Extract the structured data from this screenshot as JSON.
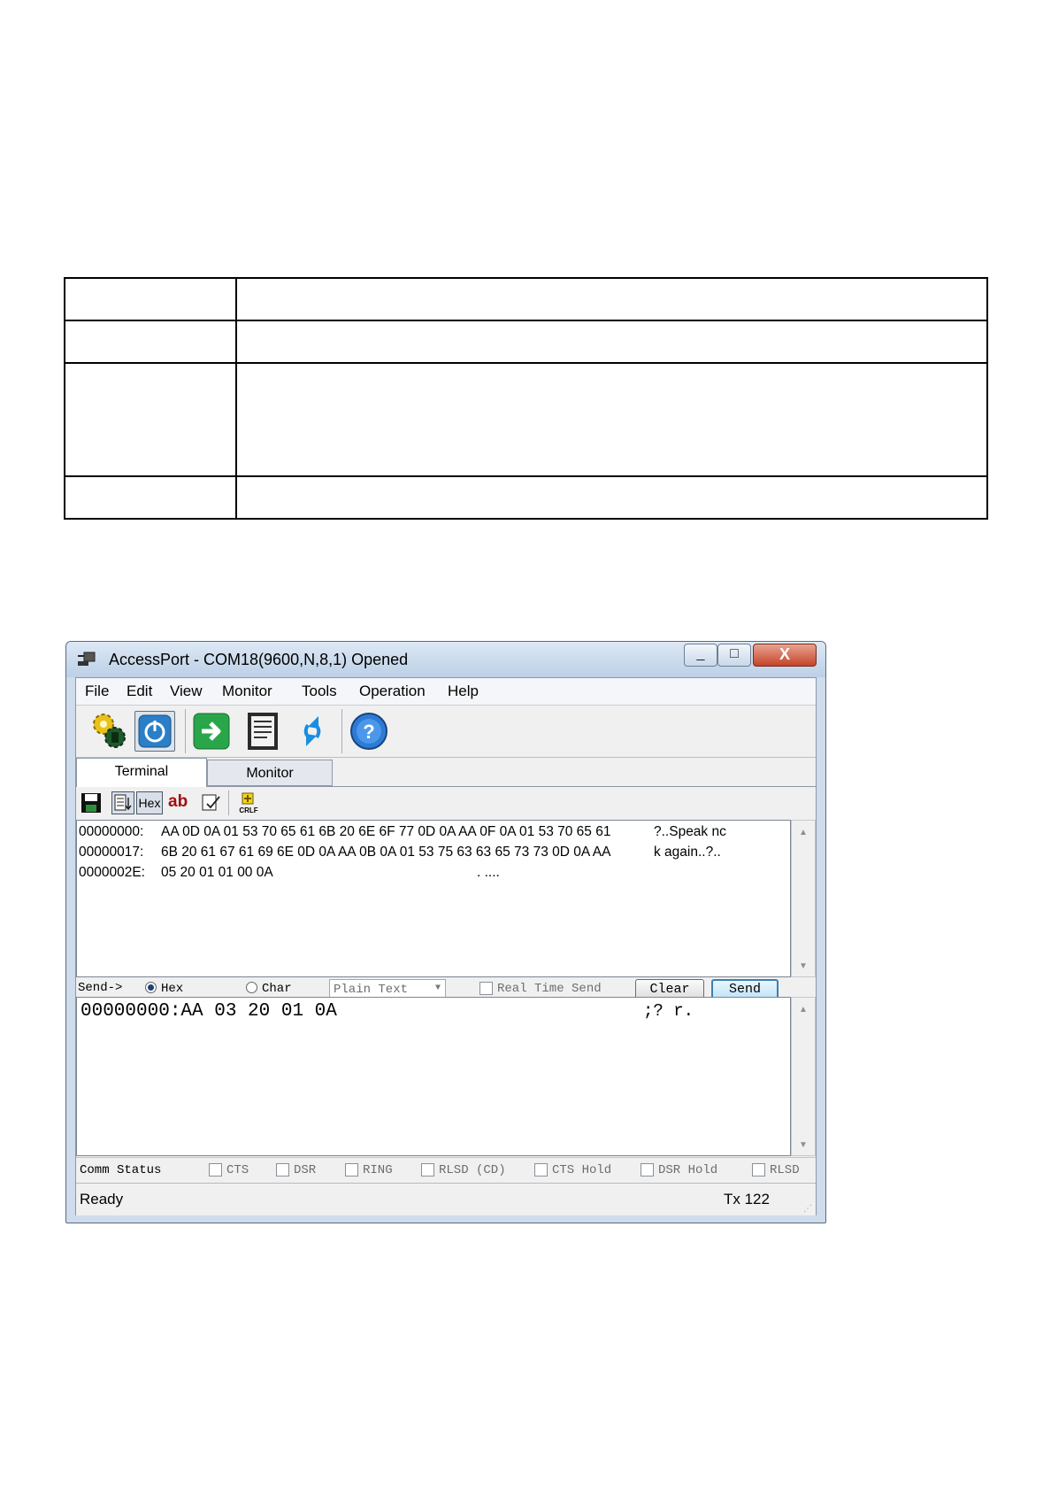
{
  "window": {
    "title": "AccessPort - COM18(9600,N,8,1) Opened",
    "close_glyph": "X",
    "min_glyph": "_",
    "max_glyph": "□"
  },
  "menu": [
    "File",
    "Edit",
    "View",
    "Monitor",
    "Tools",
    "Operation",
    "Help"
  ],
  "toolbar": {
    "icons": [
      "settings-gears-icon",
      "power-icon",
      "arrow-right-icon",
      "document-icon",
      "refresh-arrows-icon",
      "help-icon"
    ]
  },
  "tabs": {
    "terminal": "Terminal",
    "monitor": "Monitor"
  },
  "subtoolbar": {
    "hex_label": "Hex",
    "ab_label": "ab",
    "crlf_label": "CRLF"
  },
  "receive": {
    "lines": [
      {
        "addr": "00000000:",
        "hex": "AA 0D 0A 01 53 70 65 61 6B 20 6E 6F 77 0D 0A AA 0F 0A 01 53 70 65 61",
        "ascii": "?..Speak nc"
      },
      {
        "addr": "00000017:",
        "hex": "6B 20 61 67 61 69 6E 0D 0A AA 0B 0A 01 53 75 63 63 65 73 73 0D 0A AA",
        "ascii": "k again..?.."
      },
      {
        "addr": "0000002E:",
        "hex": "05 20 01 01 00 0A",
        "ascii": ". ...."
      }
    ]
  },
  "send": {
    "label": "Send->",
    "hex_option": "Hex",
    "char_option": "Char",
    "format": "Plain Text",
    "realtime_label": "Real Time Send",
    "clear_label": "Clear",
    "send_label": "Send",
    "line": "00000000:AA 03 20 01 0A",
    "ascii": ";? r."
  },
  "comm_status": {
    "label": "Comm Status",
    "items": [
      "CTS",
      "DSR",
      "RING",
      "RLSD (CD)",
      "CTS Hold",
      "DSR Hold",
      "RLSD"
    ]
  },
  "statusbar": {
    "left": "Ready",
    "right": "Tx 122"
  }
}
